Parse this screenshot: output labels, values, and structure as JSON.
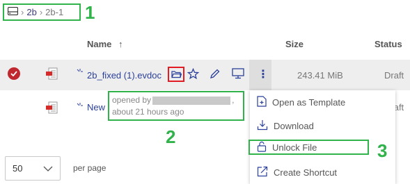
{
  "breadcrumb": {
    "root_icon": "drive-icon",
    "items": [
      "2b",
      "2b-1"
    ]
  },
  "callouts": [
    "1",
    "2",
    "3"
  ],
  "table": {
    "columns": {
      "name": "Name",
      "sort_arrow": "↑",
      "size": "Size",
      "status": "Status"
    },
    "rows": [
      {
        "name": "2b_fixed (1).evdoc",
        "size": "243.41 MiB",
        "status": "Draft",
        "selected": true
      },
      {
        "name": "New",
        "size": "",
        "status": "Draft",
        "selected": false
      }
    ]
  },
  "tooltip": {
    "prefix": "opened by",
    "suffix": ",",
    "time": "about 21 hours ago"
  },
  "row_menu_icon": "⋮",
  "menu": {
    "items": [
      {
        "label": "Open as Template",
        "icon": "template-icon"
      },
      {
        "label": "Download",
        "icon": "download-icon"
      },
      {
        "label": "Unlock File",
        "icon": "unlock-icon"
      },
      {
        "label": "Create Shortcut",
        "icon": "shortcut-icon"
      }
    ]
  },
  "pager": {
    "page_size": "50",
    "per_page_label": "per page"
  },
  "colors": {
    "highlight_green": "#2fb34a",
    "highlight_red": "#e31b23",
    "link": "#2a3f9a",
    "selected_check": "#c0282f"
  }
}
